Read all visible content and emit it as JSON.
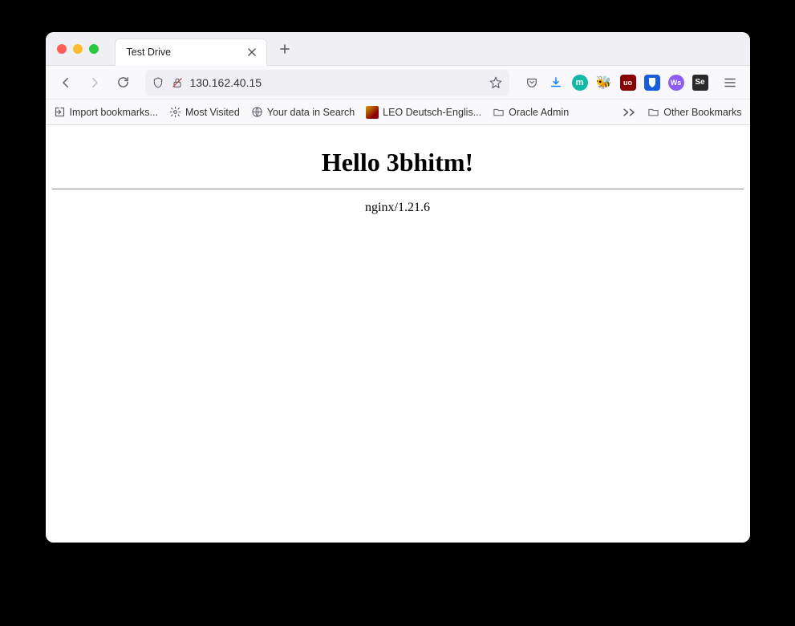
{
  "tab": {
    "title": "Test Drive"
  },
  "url": "130.162.40.15",
  "bookmarks": {
    "import": "Import bookmarks...",
    "mostVisited": "Most Visited",
    "yourData": "Your data in Search",
    "leo": "LEO Deutsch-Englis...",
    "oracle": "Oracle Admin",
    "other": "Other Bookmarks"
  },
  "extensions": {
    "m": "m",
    "ub": "uo",
    "ws": "Ws",
    "se": "Se"
  },
  "page": {
    "heading": "Hello 3bhitm!",
    "server": "nginx/1.21.6"
  }
}
